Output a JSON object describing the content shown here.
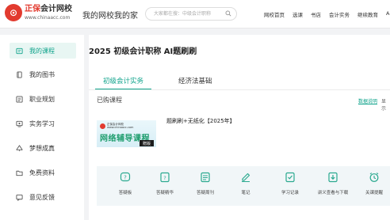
{
  "header": {
    "logo_brand": "正保",
    "logo_rest": "会计网校",
    "logo_url": "www.chinaacc.com",
    "site_title": "我的网校我的家",
    "search_placeholder": "大家都在搜：中级会计职称",
    "nav": [
      "网校首页",
      "选课",
      "书店",
      "会计实务",
      "继续教育",
      "Ap"
    ]
  },
  "sidebar": {
    "items": [
      {
        "label": "我的课程",
        "icon": "course-icon",
        "active": true
      },
      {
        "label": "我的图书",
        "icon": "book-icon",
        "active": false
      },
      {
        "label": "职业规划",
        "icon": "career-icon",
        "active": false
      },
      {
        "label": "实务学习",
        "icon": "practice-icon",
        "active": false
      },
      {
        "label": "梦想成真",
        "icon": "dream-icon",
        "active": false
      },
      {
        "label": "免费资料",
        "icon": "folder-icon",
        "active": false
      },
      {
        "label": "意见反馈",
        "icon": "feedback-icon",
        "active": false
      }
    ]
  },
  "main": {
    "page_title": "2025 初级会计职称 AI题刷刷",
    "tabs": [
      {
        "label": "初级会计实务",
        "active": true
      },
      {
        "label": "经济法基础",
        "active": false
      }
    ],
    "purchased_label": "已购课程",
    "stats_link": "数据说明",
    "show_text": "显示",
    "banner": {
      "brand": "正保会计网校",
      "brand_url": "www.chinaacc.com",
      "title": "网络辅导课程",
      "badge": "赠版"
    },
    "course_name": "题刷刷+无纸化【2025年】",
    "tools": [
      {
        "label": "答疑板",
        "icon": "question-icon"
      },
      {
        "label": "答疑精华",
        "icon": "essence-icon"
      },
      {
        "label": "答疑周刊",
        "icon": "weekly-icon"
      },
      {
        "label": "笔记",
        "icon": "note-icon"
      },
      {
        "label": "学习记录",
        "icon": "record-icon"
      },
      {
        "label": "讲义查看与下载",
        "icon": "download-icon"
      },
      {
        "label": "关课提醒",
        "icon": "alarm-icon"
      }
    ]
  },
  "colors": {
    "accent": "#0fa38b",
    "brand_red": "#e23b2f",
    "active_bg": "#e8f6f3",
    "tools_bg": "#f1f6f8"
  }
}
